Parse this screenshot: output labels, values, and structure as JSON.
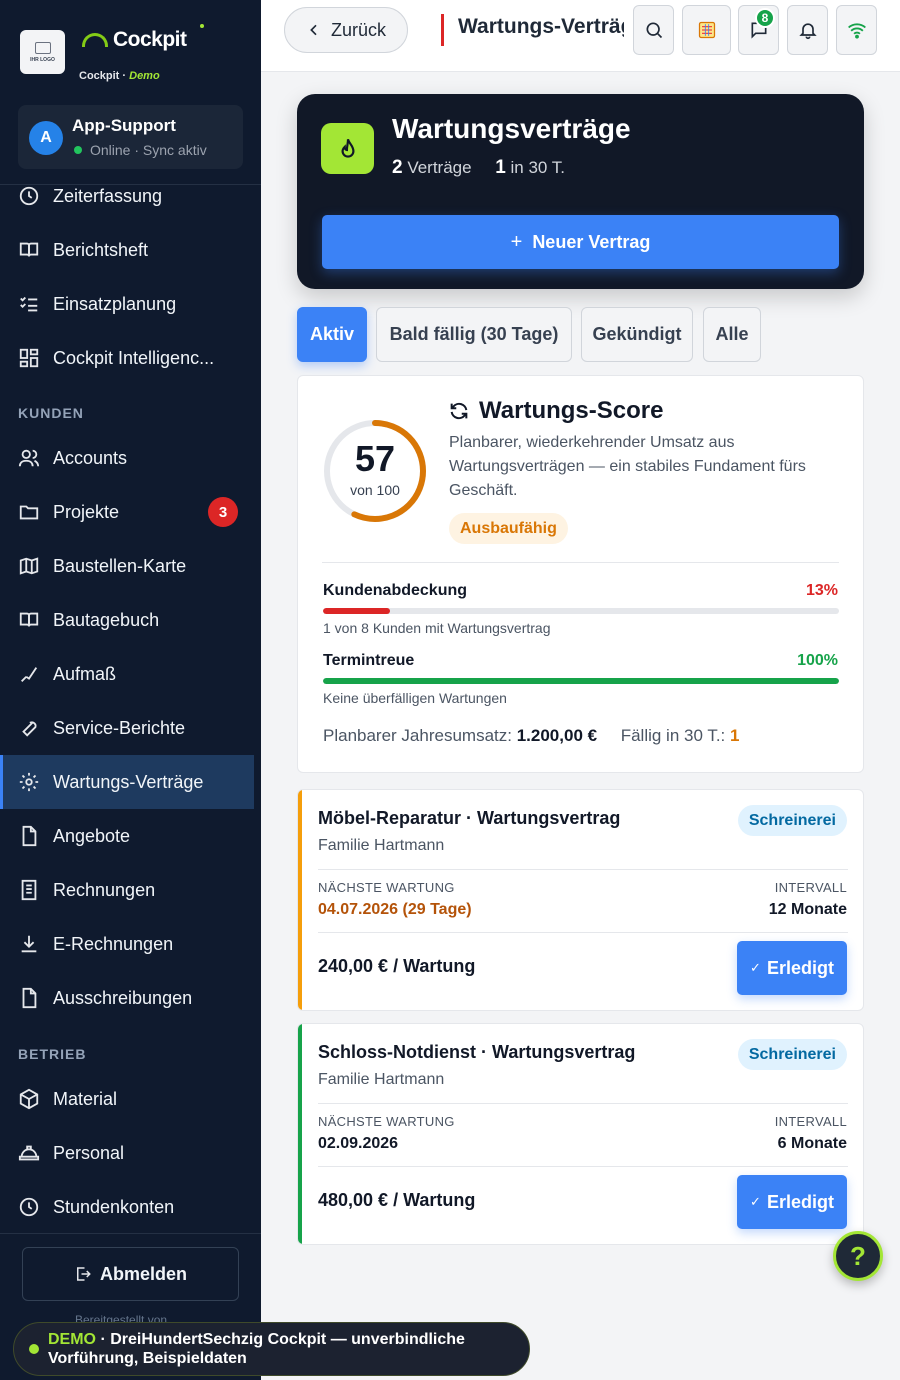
{
  "brand": {
    "logo_caption": "IHR LOGO",
    "name": "Cockpit",
    "sub_prefix": "Cockpit ·",
    "sub_demo": "Demo"
  },
  "user": {
    "initial": "A",
    "name": "App-Support",
    "status": "Online · Sync aktiv"
  },
  "sidebar": {
    "items_top": [
      {
        "label": "Zeiterfassung",
        "icon": "clock-icon"
      },
      {
        "label": "Berichtsheft",
        "icon": "book-icon"
      },
      {
        "label": "Einsatzplanung",
        "icon": "checklist-icon"
      },
      {
        "label": "Cockpit Intelligenc...",
        "icon": "dashboard-icon"
      }
    ],
    "section_kunden": "KUNDEN",
    "items_kunden": [
      {
        "label": "Accounts",
        "icon": "users-icon"
      },
      {
        "label": "Projekte",
        "icon": "folder-icon",
        "badge": "3"
      },
      {
        "label": "Baustellen-Karte",
        "icon": "map-icon"
      },
      {
        "label": "Bautagebuch",
        "icon": "book-icon"
      },
      {
        "label": "Aufmaß",
        "icon": "measure-icon"
      },
      {
        "label": "Service-Berichte",
        "icon": "wrench-icon"
      },
      {
        "label": "Wartungs-Verträge",
        "icon": "gear-icon",
        "active": true
      },
      {
        "label": "Angebote",
        "icon": "document-icon"
      },
      {
        "label": "Rechnungen",
        "icon": "receipt-icon"
      },
      {
        "label": "E-Rechnungen",
        "icon": "download-icon"
      },
      {
        "label": "Ausschreibungen",
        "icon": "document-icon"
      }
    ],
    "section_betrieb": "BETRIEB",
    "items_betrieb": [
      {
        "label": "Material",
        "icon": "box-icon"
      },
      {
        "label": "Personal",
        "icon": "helmet-icon"
      },
      {
        "label": "Stundenkonten",
        "icon": "clock-icon"
      }
    ],
    "logout": "Abmelden",
    "provided_by": "Bereitgestellt von"
  },
  "topbar": {
    "back": "Zurück",
    "title": "Wartungs-Verträge",
    "chat_badge": "8"
  },
  "hero": {
    "title": "Wartungsverträge",
    "count": "2",
    "count_label": "Verträge",
    "due": "1",
    "due_label": "in 30 T.",
    "new_button": "Neuer Vertrag"
  },
  "tabs": [
    {
      "label": "Aktiv",
      "active": true
    },
    {
      "label": "Bald fällig (30 Tage)"
    },
    {
      "label": "Gekündigt"
    },
    {
      "label": "Alle"
    }
  ],
  "score": {
    "value": "57",
    "value_num": 57,
    "of": "von 100",
    "title": "Wartungs-Score",
    "description": "Planbarer, wiederkehrender Umsatz aus Wartungsverträgen — ein stabiles Fundament fürs Geschäft.",
    "rating": "Ausbaufähig",
    "ring_color": "#d97706",
    "metrics": [
      {
        "label": "Kundenabdeckung",
        "value": "13%",
        "pct": 13,
        "color": "#dc2626",
        "note": "1 von 8 Kunden mit Wartungsvertrag"
      },
      {
        "label": "Termintreue",
        "value": "100%",
        "pct": 100,
        "color": "#16a34a",
        "note": "Keine überfälligen Wartungen"
      }
    ],
    "revenue_label": "Planbarer Jahresumsatz:",
    "revenue_value": "1.200,00 €",
    "due_label": "Fällig in 30 T.:",
    "due_value": "1"
  },
  "contracts": [
    {
      "title": "Möbel-Reparatur · Wartungsvertrag",
      "client": "Familie Hartmann",
      "tag": "Schreinerei",
      "next_label": "NÄCHSTE WARTUNG",
      "next_value": "04.07.2026 (29 Tage)",
      "interval_label": "INTERVALL",
      "interval_value": "12 Monate",
      "price": "240,00 € / Wartung",
      "action": "Erledigt",
      "stripe": "#f59e0b",
      "next_color": "#b45309"
    },
    {
      "title": "Schloss-Notdienst · Wartungsvertrag",
      "client": "Familie Hartmann",
      "tag": "Schreinerei",
      "next_label": "NÄCHSTE WARTUNG",
      "next_value": "02.09.2026",
      "interval_label": "INTERVALL",
      "interval_value": "6 Monate",
      "price": "480,00 € / Wartung",
      "action": "Erledigt",
      "stripe": "#16a34a",
      "next_color": "#111827"
    }
  ],
  "help": "?",
  "demo_banner": {
    "label": "DEMO",
    "text": "· DreiHundertSechzig Cockpit — unverbindliche Vorführung, Beispieldaten"
  }
}
